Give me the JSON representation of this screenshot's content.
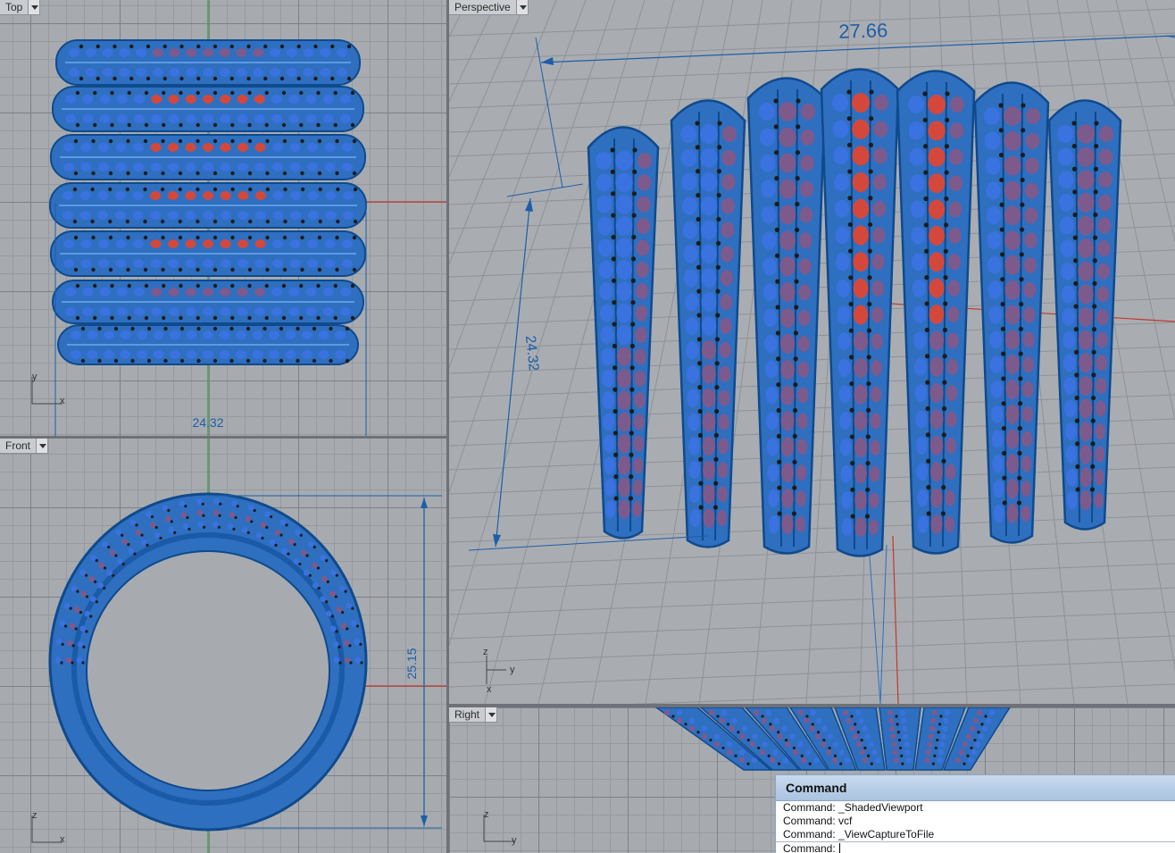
{
  "viewports": {
    "top": {
      "label": "Top",
      "dimension": "24.32",
      "axis": {
        "a": "y",
        "b": "x"
      }
    },
    "front": {
      "label": "Front",
      "dimension": "25.15",
      "axis": {
        "a": "z",
        "b": "x"
      }
    },
    "perspective": {
      "label": "Perspective",
      "dim_width": "27.66",
      "dim_height": "24.32",
      "axis": {
        "a": "z",
        "b": "y",
        "c": "x"
      }
    },
    "right": {
      "label": "Right",
      "axis": {
        "a": "z",
        "b": "y"
      }
    }
  },
  "colors": {
    "ring_blue": "#2f6fc0",
    "ring_edge": "#0f4a8c",
    "stone_blue": "#3a72e0",
    "stone_red": "#d4483c",
    "stone_purple": "#7d5a8c",
    "prong": "#1c1c1c",
    "dimension": "#1d5ea8"
  },
  "command": {
    "title": "Command",
    "history": [
      "Command: _ShadedViewport",
      "Command: vcf",
      "Command: _ViewCaptureToFile"
    ],
    "prompt": "Command:"
  }
}
